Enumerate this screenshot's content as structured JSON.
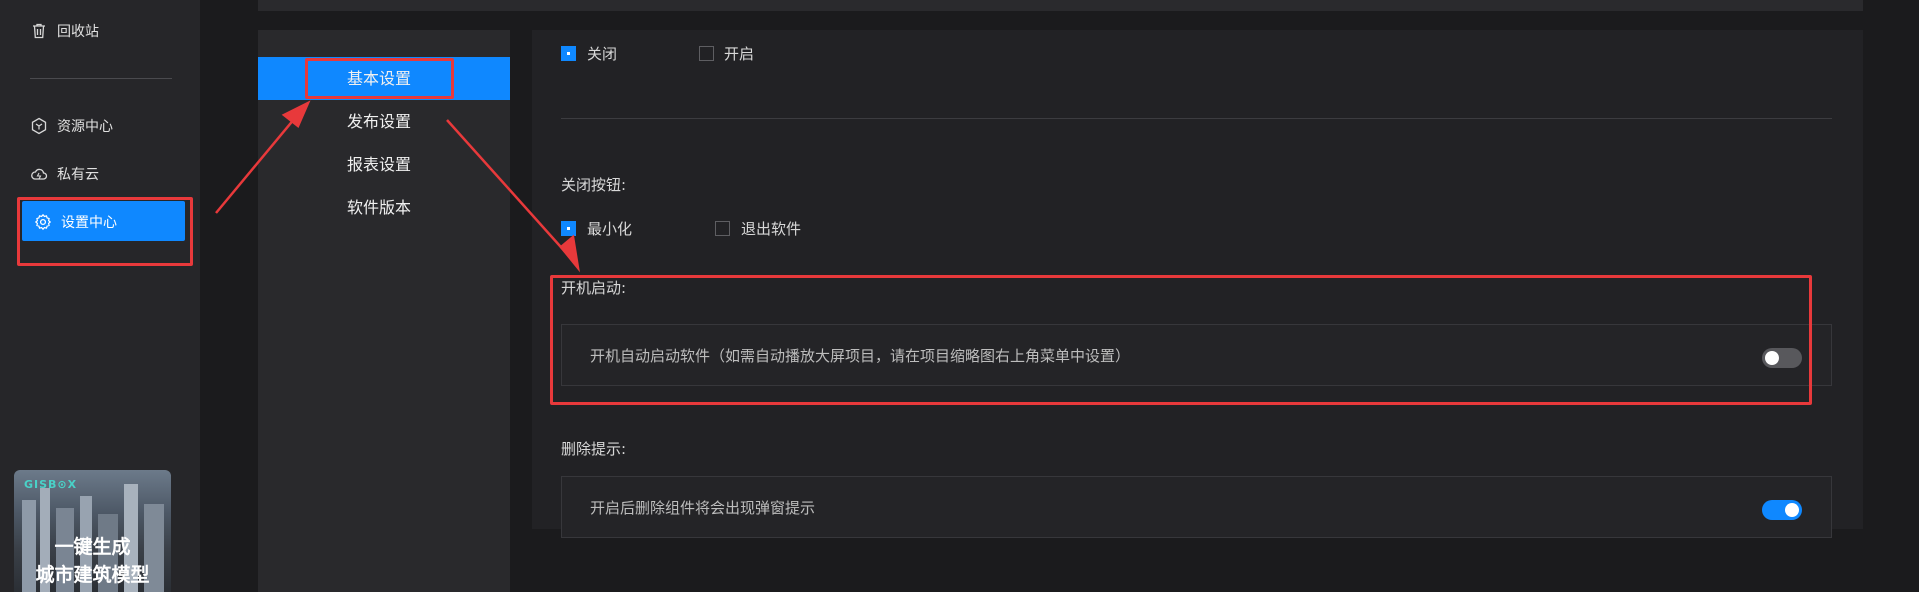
{
  "sidebar": {
    "items": [
      {
        "label": "回收站",
        "icon": "trash-icon"
      },
      {
        "label": "资源中心",
        "icon": "hexagon-icon"
      },
      {
        "label": "私有云",
        "icon": "cloud-icon"
      },
      {
        "label": "设置中心",
        "icon": "gear-icon"
      }
    ],
    "banner": {
      "brand": "GISB⊙X",
      "line1": "一键生成",
      "line2": "城市建筑模型"
    }
  },
  "submenu": {
    "items": [
      "基本设置",
      "发布设置",
      "报表设置",
      "软件版本"
    ],
    "active": "基本设置"
  },
  "settings": {
    "top_options": [
      {
        "label": "关闭",
        "checked": true
      },
      {
        "label": "开启",
        "checked": false
      }
    ],
    "close_button": {
      "title": "关闭按钮:",
      "options": [
        {
          "label": "最小化",
          "checked": true
        },
        {
          "label": "退出软件",
          "checked": false
        }
      ]
    },
    "startup": {
      "title": "开机启动:",
      "text": "开机自动启动软件（如需自动播放大屏项目，请在项目缩略图右上角菜单中设置）",
      "enabled": false
    },
    "delete_prompt": {
      "title": "删除提示:",
      "text": "开启后删除组件将会出现弹窗提示",
      "enabled": true
    }
  },
  "colors": {
    "accent": "#0f88ff",
    "annotation": "#e8393b",
    "background": "#1b1b1d"
  }
}
